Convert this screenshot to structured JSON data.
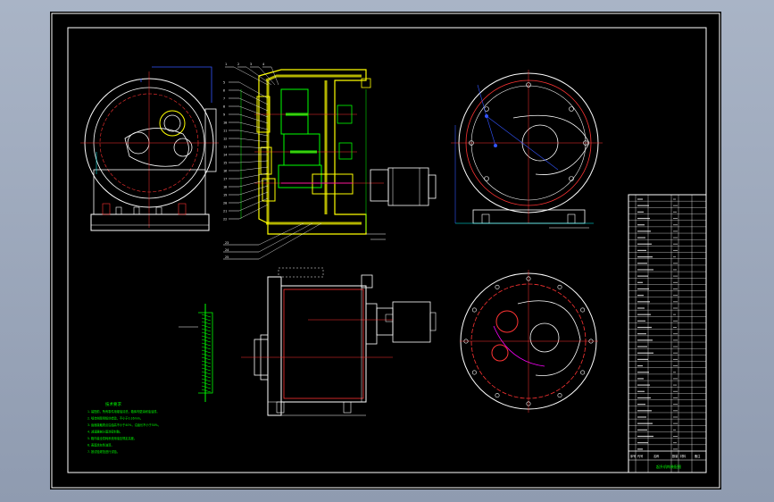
{
  "drawing": {
    "background_color": "#000000",
    "frame_color": "#ffffff",
    "window_bg_color": "#9aa6ba",
    "line_colors": {
      "outline": "#ffffff",
      "centerline": "#ff3333",
      "dimension": "#00ffff",
      "leader": "#ffffff",
      "housing": "#ffff00",
      "gear": "#00ff00",
      "hidden": "#ff00ff",
      "blue": "#3355ff",
      "section": "#ff4040"
    },
    "views": [
      {
        "name": "front-view",
        "label": ""
      },
      {
        "name": "section-view",
        "label": ""
      },
      {
        "name": "side-view-right",
        "label": ""
      },
      {
        "name": "top-view",
        "label": ""
      },
      {
        "name": "rear-view",
        "label": ""
      },
      {
        "name": "detail-view",
        "label": ""
      }
    ]
  },
  "technical_notes": {
    "title": "技术要求",
    "color": "#00ff00",
    "lines": [
      "1. 装配前，所有零件用煤油清洗，箱体内壁涂耐油油漆。",
      "2. 啮合侧隙用铅丝检验，不小于0.16mm。",
      "3. 齿面接触斑点沿齿高不小于40%，沿齿长不小于50%。",
      "4. 减速器剖分面涂密封胶。",
      "5. 箱内装全损耗系统用油至规定高度。",
      "6. 表面涂灰色油漆。",
      "7. 按试验规范进行试验。"
    ]
  },
  "title_block": {
    "rows": 40,
    "footer_labels": [
      "序号",
      "代号",
      "名称",
      "数量",
      "材料",
      "备注"
    ],
    "title_text": "起升机构装配图"
  },
  "leader_labels": {
    "section_top": [
      "1",
      "2",
      "3",
      "4"
    ],
    "section_left": [
      "5",
      "6",
      "7",
      "8",
      "9",
      "10",
      "11",
      "12",
      "13",
      "14",
      "15",
      "16",
      "17",
      "18",
      "19",
      "20",
      "21",
      "22"
    ],
    "section_bottom": [
      "23",
      "24",
      "25"
    ]
  }
}
